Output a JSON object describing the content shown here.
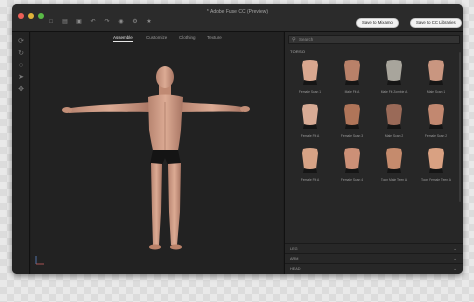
{
  "window": {
    "title": "* Adobe Fuse CC (Preview)",
    "buttons": {
      "mixamo": "Save to Mixamo",
      "cc_libraries": "Save to CC Libraries"
    },
    "toolbar_icons": [
      "new-file-icon",
      "open-folder-icon",
      "save-icon",
      "undo-icon",
      "redo-icon",
      "camera-icon",
      "gear-icon",
      "star-icon"
    ]
  },
  "left_tools": [
    "rotate-icon",
    "orbit-icon",
    "zoom-icon",
    "select-icon",
    "move-icon"
  ],
  "viewport": {
    "tabs": [
      {
        "label": "Assemble",
        "active": true
      },
      {
        "label": "Customize",
        "active": false
      },
      {
        "label": "Clothing",
        "active": false
      },
      {
        "label": "Texture",
        "active": false
      }
    ]
  },
  "panel": {
    "search_placeholder": "Search",
    "section": "TORSO",
    "items": [
      {
        "label": "Female Scan 1",
        "skin": "#d9a78f"
      },
      {
        "label": "Male Fit A",
        "skin": "#b98169"
      },
      {
        "label": "Male Fit Zombie A",
        "skin": "#a8a59c"
      },
      {
        "label": "Male Scan 1",
        "skin": "#c99680"
      },
      {
        "label": "Female Fit A",
        "skin": "#d8ab95"
      },
      {
        "label": "Female Scan 3",
        "skin": "#b07559"
      },
      {
        "label": "Male Scan 2",
        "skin": "#9a6a58"
      },
      {
        "label": "Female Scan 2",
        "skin": "#c28870"
      },
      {
        "label": "Female Fit A",
        "skin": "#d7a386"
      },
      {
        "label": "Female Scan 4",
        "skin": "#cc9077"
      },
      {
        "label": "Toon Male Teen A",
        "skin": "#c58b6d"
      },
      {
        "label": "Toon Female Teen A",
        "skin": "#d9a182"
      }
    ],
    "collapsed_sections": [
      "LEG",
      "ARM",
      "HEAD"
    ]
  }
}
